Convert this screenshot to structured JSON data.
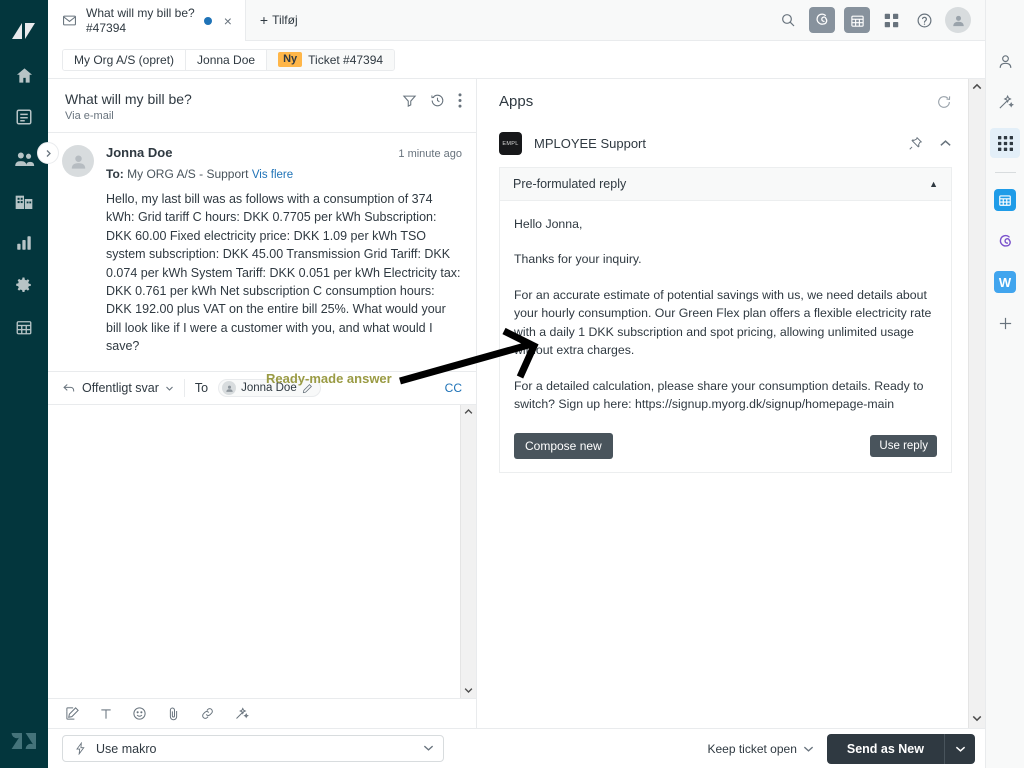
{
  "left_nav": {
    "brand_icon": "zendesk-mark-icon",
    "items": [
      {
        "icon": "home-icon",
        "name": "home"
      },
      {
        "icon": "views-icon",
        "name": "views"
      },
      {
        "icon": "customers-icon",
        "name": "customers"
      },
      {
        "icon": "organizations-icon",
        "name": "organizations"
      },
      {
        "icon": "reporting-icon",
        "name": "reporting"
      },
      {
        "icon": "settings-gear-icon",
        "name": "settings"
      },
      {
        "icon": "calendar-grid-icon",
        "name": "calendar"
      }
    ],
    "footer_icon": "zendesk-logo-icon"
  },
  "topbar": {
    "tab": {
      "icon": "mail-icon",
      "title": "What will my bill be?",
      "subtitle": "#47394",
      "unsaved_indicator": true,
      "close_label": "×"
    },
    "add_tab_label": "Tilføj",
    "add_tab_plus": "+",
    "right_icons": [
      {
        "name": "search-icon"
      },
      {
        "name": "talk-swirl-icon"
      },
      {
        "name": "calendar-icon"
      },
      {
        "name": "apps-grid-icon"
      },
      {
        "name": "help-question-icon"
      },
      {
        "name": "user-avatar-icon"
      }
    ]
  },
  "breadcrumb": {
    "items": [
      {
        "label": "My Org A/S (opret)"
      },
      {
        "label": "Jonna Doe"
      },
      {
        "badge": "Ny",
        "label": "Ticket #47394"
      }
    ]
  },
  "ticket": {
    "subject": "What will my bill be?",
    "via": "Via e-mail",
    "header_icons": [
      {
        "name": "filter-icon"
      },
      {
        "name": "history-clock-icon"
      },
      {
        "name": "more-options-icon"
      }
    ],
    "comment": {
      "author": "Jonna Doe",
      "time": "1 minute ago",
      "to_label": "To:",
      "to_value": "My ORG A/S - Support",
      "show_more": "Vis flere",
      "body": "Hello, my last bill was as follows with a consumption of 374 kWh: Grid tariff C hours: DKK 0.7705 per kWh Subscription: DKK 60.00 Fixed electricity price: DKK 1.09 per kWh TSO system subscription: DKK 45.00 Transmission Grid Tariff: DKK 0.074 per kWh System Tariff: DKK 0.051 per kWh Electricity tax: DKK 0.761 per kWh Net subscription C consumption hours: DKK 192.00 plus VAT on the entire bill 25%. What would your bill look like if I were a customer with you, and what would I save?"
    }
  },
  "composer": {
    "channel": "Offentligt svar",
    "to_label": "To",
    "recipient": "Jonna Doe",
    "cc_label": "CC",
    "body_value": "",
    "body_placeholder": "",
    "tools": [
      {
        "name": "rich-text-compose-icon"
      },
      {
        "name": "text-format-icon"
      },
      {
        "name": "emoji-icon"
      },
      {
        "name": "attachment-clip-icon"
      },
      {
        "name": "link-icon"
      },
      {
        "name": "magic-wand-icon"
      }
    ]
  },
  "apps": {
    "title": "Apps",
    "refresh_icon": "refresh-icon",
    "app": {
      "logo_text": "EMPL",
      "name": "MPLOYEE Support",
      "pin_icon": "pin-icon",
      "collapse_icon": "chevron-up-icon",
      "section_title": "Pre-formulated reply",
      "section_caret": "▲",
      "paragraphs": [
        "Hello Jonna,",
        "Thanks for your inquiry.",
        "For an accurate estimate of potential savings with us, we need details about your hourly consumption. Our Green Flex plan offers a flexible electricity rate with a daily 1 DKK subscription and spot pricing, allowing unlimited usage without extra charges.",
        "For a detailed calculation, please share your consumption details. Ready to switch? Sign up here: https://signup.myorg.dk/signup/homepage-main"
      ],
      "compose_new_label": "Compose new",
      "use_reply_label": "Use reply"
    }
  },
  "right_rail": {
    "items": [
      {
        "name": "user-profile-icon",
        "active": false
      },
      {
        "name": "magic-wand-icon",
        "active": false
      },
      {
        "name": "apps-grid-icon",
        "active": true
      }
    ],
    "app_items": [
      {
        "name": "calendar-app-icon",
        "color": "#1f9ce8",
        "glyph": "▦"
      },
      {
        "name": "talk-swirl-app-icon",
        "color": "#7a52cc",
        "glyph": "6"
      },
      {
        "name": "word-app-icon",
        "color": "#41a5ee",
        "glyph": "W"
      }
    ],
    "add_label": "+"
  },
  "bottombar": {
    "macro_icon": "lightning-bolt-icon",
    "macro_label": "Use makro",
    "macro_caret": "⌄",
    "keep_open_label": "Keep ticket open",
    "send_label": "Send as New",
    "send_caret": "⌄"
  },
  "annotation": {
    "label": "Ready-made answer",
    "color": "#9a9b44",
    "arrow": "points from label right-upward to app reply body"
  },
  "colors": {
    "nav_background": "#03363D",
    "accent_blue": "#1f73b7",
    "badge_amber": "#ffb648",
    "button_dark": "#49545c",
    "send_button": "#2f3941",
    "annotation_olive": "#9a9b44"
  }
}
